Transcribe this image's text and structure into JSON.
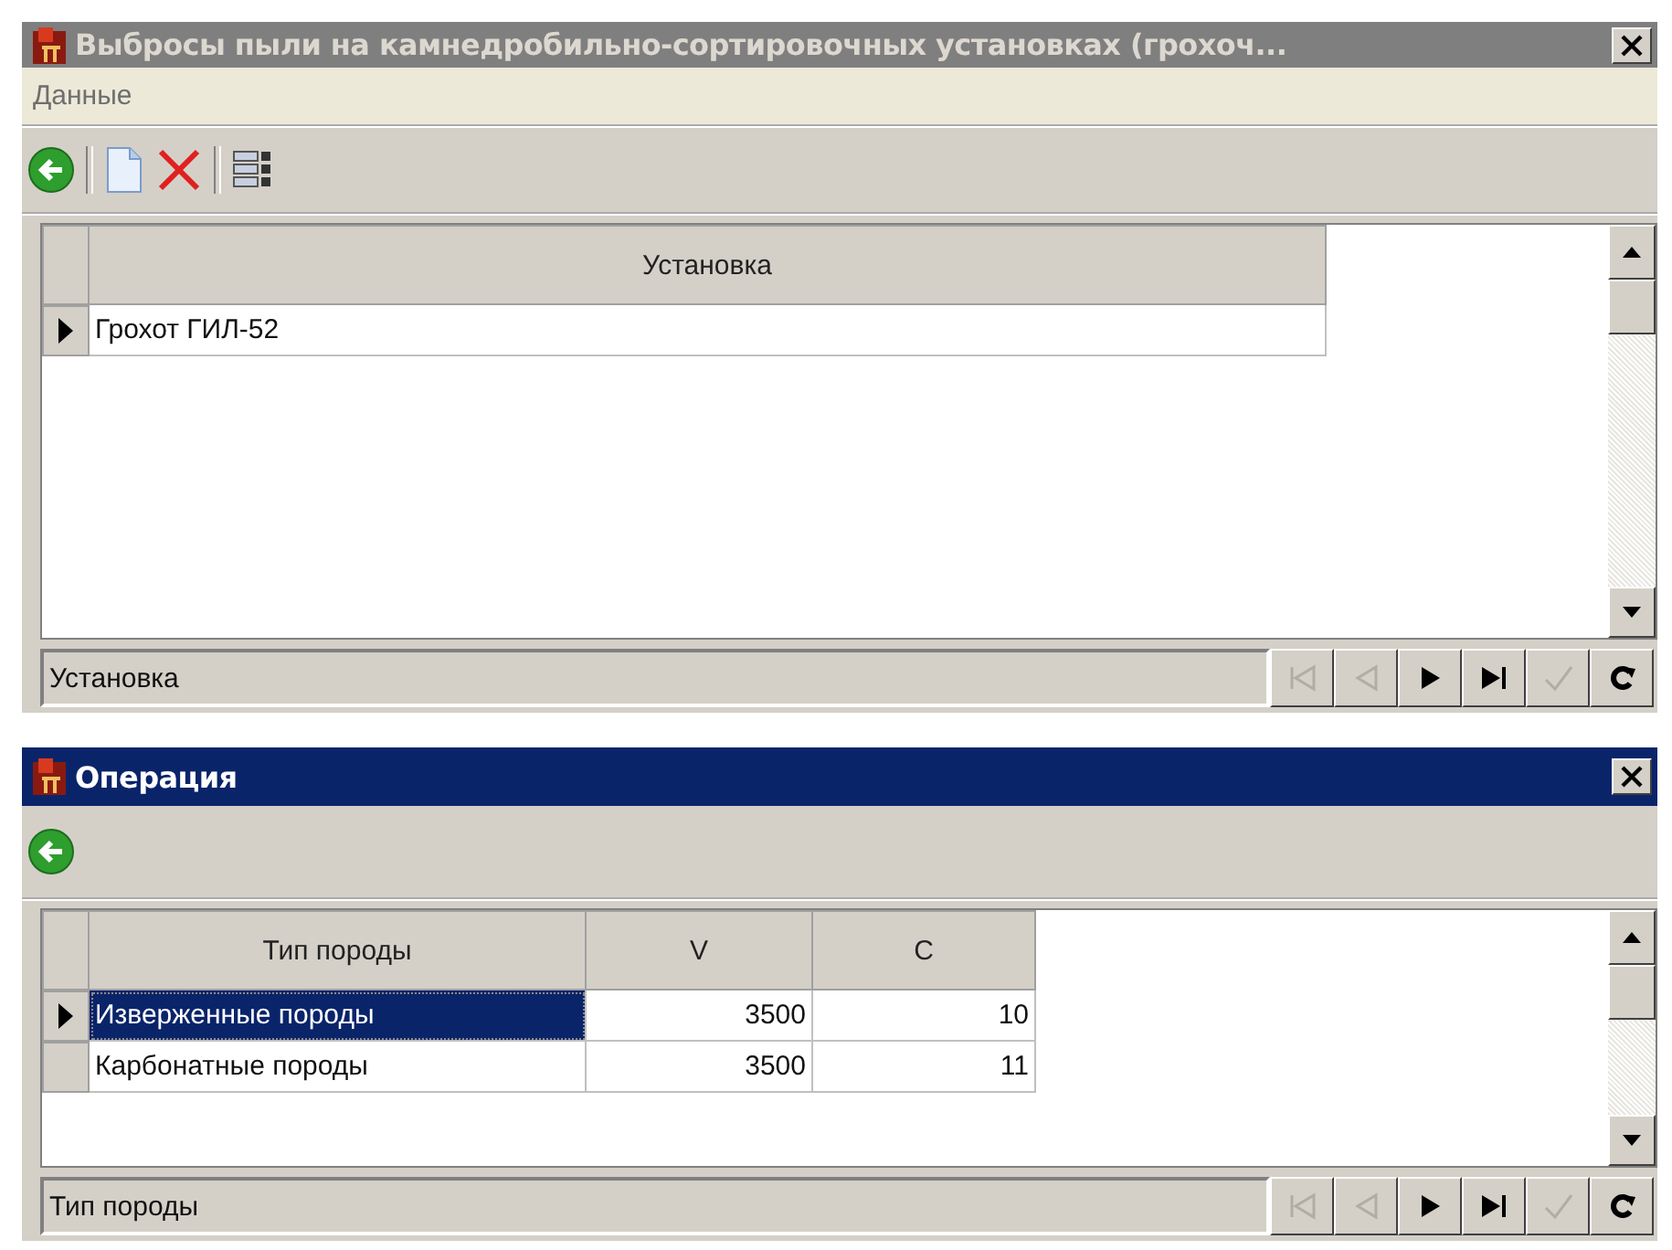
{
  "window": {
    "title": "Выбросы пыли на камнедробильно-сортировочных установках (грохоч...",
    "active": false
  },
  "menu": [
    {
      "label": "Данные"
    }
  ],
  "toolbar": [
    {
      "kind": "back"
    },
    {
      "kind": "separator"
    },
    {
      "kind": "new"
    },
    {
      "kind": "delete"
    },
    {
      "kind": "separator"
    },
    {
      "kind": "columns"
    }
  ],
  "grid": {
    "columns": [
      {
        "label": "Установка"
      }
    ],
    "rows": [
      {
        "cells": [
          "Грохот ГИЛ-52"
        ],
        "current": true,
        "selected": false
      }
    ]
  },
  "status_bar": {
    "label": "Установка",
    "nav_buttons": [
      {
        "kind": "first",
        "disabled": true
      },
      {
        "kind": "prior",
        "disabled": true
      },
      {
        "kind": "next",
        "disabled": false
      },
      {
        "kind": "last",
        "disabled": false
      },
      {
        "kind": "post",
        "disabled": true
      },
      {
        "kind": "refresh",
        "disabled": false
      }
    ]
  },
  "subwindow": {
    "title": "Операция",
    "active": true,
    "toolbar": [
      {
        "kind": "back"
      }
    ],
    "grid": {
      "columns": [
        {
          "label": "Тип породы",
          "kind": "text"
        },
        {
          "label": "V",
          "kind": "number"
        },
        {
          "label": "C",
          "kind": "number"
        }
      ],
      "rows": [
        {
          "cells": [
            "Изверженные породы",
            "3500",
            "10"
          ],
          "current": true,
          "selected": true
        },
        {
          "cells": [
            "Карбонатные породы",
            "3500",
            "11"
          ],
          "current": false,
          "selected": false
        }
      ]
    },
    "status_bar": {
      "label": "Тип породы",
      "nav_buttons": [
        {
          "kind": "first",
          "disabled": true
        },
        {
          "kind": "prior",
          "disabled": true
        },
        {
          "kind": "next",
          "disabled": false
        },
        {
          "kind": "last",
          "disabled": false
        },
        {
          "kind": "post",
          "disabled": true
        },
        {
          "kind": "refresh",
          "disabled": false
        }
      ]
    }
  }
}
